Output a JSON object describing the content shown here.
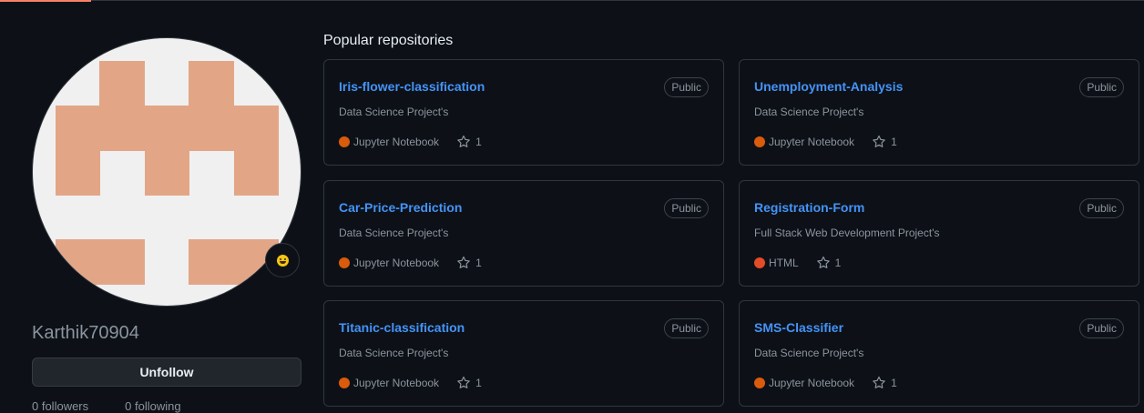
{
  "profile": {
    "username": "Karthik70904",
    "unfollow_label": "Unfollow",
    "followers_text": "0 followers",
    "following_text": "0 following",
    "status_icon": "smiley-icon"
  },
  "section_title": "Popular repositories",
  "repos": [
    {
      "name": "Iris-flower-classification",
      "visibility": "Public",
      "description": "Data Science Project's",
      "language": "Jupyter Notebook",
      "lang_color": "#DA5B0B",
      "stars": "1"
    },
    {
      "name": "Unemployment-Analysis",
      "visibility": "Public",
      "description": "Data Science Project's",
      "language": "Jupyter Notebook",
      "lang_color": "#DA5B0B",
      "stars": "1"
    },
    {
      "name": "Car-Price-Prediction",
      "visibility": "Public",
      "description": "Data Science Project's",
      "language": "Jupyter Notebook",
      "lang_color": "#DA5B0B",
      "stars": "1"
    },
    {
      "name": "Registration-Form",
      "visibility": "Public",
      "description": "Full Stack Web Development Project's",
      "language": "HTML",
      "lang_color": "#e34c26",
      "stars": "1"
    },
    {
      "name": "Titanic-classification",
      "visibility": "Public",
      "description": "Data Science Project's",
      "language": "Jupyter Notebook",
      "lang_color": "#DA5B0B",
      "stars": "1"
    },
    {
      "name": "SMS-Classifier",
      "visibility": "Public",
      "description": "Data Science Project's",
      "language": "Jupyter Notebook",
      "lang_color": "#DA5B0B",
      "stars": "1"
    }
  ],
  "colors": {
    "accent_link": "#4493f8",
    "identicon": "#e2a687",
    "background": "#0d1117"
  }
}
